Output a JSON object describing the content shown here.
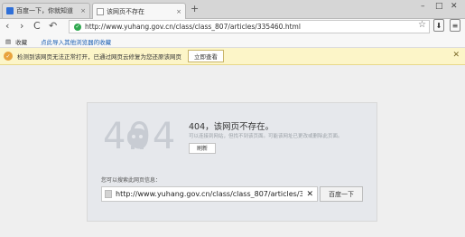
{
  "tabs": [
    {
      "title": "百度一下，你就知道",
      "active": false
    },
    {
      "title": "该网页不存在",
      "active": true
    }
  ],
  "new_tab": "+",
  "window_controls": [
    "–",
    "□",
    "✕"
  ],
  "nav": {
    "back": "‹",
    "forward": "›",
    "reload": "C",
    "home": "↶"
  },
  "url": "http://www.yuhang.gov.cn/class/class_807/articles/335460.html",
  "bookmarks": {
    "label": "收藏",
    "import_link": "点此导入其他浏览器的收藏"
  },
  "notification": {
    "text": "检测到该网页无法正常打开，已通过网页云修复为您还原该网页",
    "button": "立即查看",
    "close": "✕"
  },
  "error": {
    "big_code": "404",
    "title": "404，该网页不存在。",
    "subtitle": "可以连接到网站，但找不到该页面。可能该网址已更改或删除此页面。",
    "refresh": "刷新",
    "search_label": "您可以搜索此网页信息：",
    "search_value": "http://www.yuhang.gov.cn/class/class_807/articles/3",
    "clear": "✕",
    "search_button": "百度一下"
  },
  "colors": {
    "accent": "#1a5fb4",
    "notif_bg": "#fcf5c8",
    "shield": "#2fa84f"
  }
}
